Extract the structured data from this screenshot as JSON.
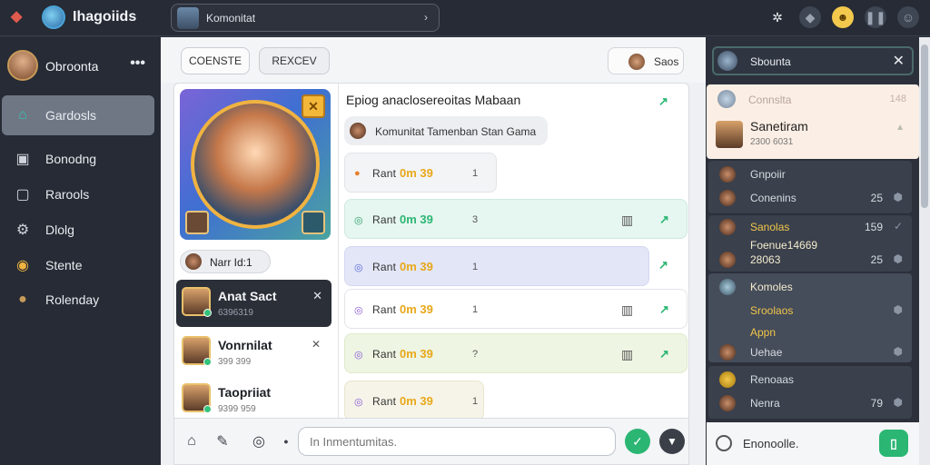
{
  "topbar": {
    "title": "Ihagoiids",
    "search_text": "Komonitat",
    "search_arrow": "›",
    "icons": [
      "gear-icon",
      "puzzle-icon",
      "emoji-icon",
      "pause-icon",
      "profile-icon"
    ]
  },
  "sidebar": {
    "user_name": "Obroonta",
    "menu_glyph": "•••",
    "items": [
      {
        "label": "Gardosls",
        "icon": "home-icon"
      },
      {
        "label": "Bonodng",
        "icon": "store-icon"
      },
      {
        "label": "Rarools",
        "icon": "frame-icon"
      },
      {
        "label": "Dlolg",
        "icon": "settings-icon"
      },
      {
        "label": "Stente",
        "icon": "coin-icon"
      },
      {
        "label": "Rolenday",
        "icon": "avatar-icon"
      }
    ]
  },
  "main": {
    "buttons": {
      "b1": "COENSTE",
      "b2": "REXCEV",
      "save": "Saos"
    },
    "tag_chip": "Narr Id:1",
    "conversations": [
      {
        "name": "Anat Sact",
        "sub": "6396319",
        "selected": true
      },
      {
        "name": "Vonrnilat",
        "sub": "399 399",
        "selected": false
      },
      {
        "name": "Taopriiat",
        "sub": "9399 959",
        "selected": false
      }
    ],
    "message_header": "Epiog anaclosereoitas Mabaan",
    "info_chip": "Komunitat Tamenban Stan Gama",
    "bubbles": [
      {
        "label": "Rant",
        "answer": "0m 39",
        "tail": "1",
        "tone": "plain"
      },
      {
        "label": "Rant",
        "answer": "0m 39",
        "tail": "3",
        "tone": "green"
      },
      {
        "label": "Rant",
        "answer": "0m 39",
        "tail": "1",
        "tone": "lavender"
      },
      {
        "label": "Rant",
        "answer": "0m 39",
        "tail": "1",
        "tone": "white"
      },
      {
        "label": "Rant",
        "answer": "0m 39",
        "tail": "?",
        "tone": "lime"
      },
      {
        "label": "Rant",
        "answer": "0m 39",
        "tail": "1",
        "tone": "cream"
      }
    ],
    "composer_placeholder": "In Inmentumitas."
  },
  "right": {
    "search_text": "Sbounta",
    "card": {
      "top_label": "Connslta",
      "top_num": "148",
      "name": "Sanetiram",
      "sub": "2300 6031"
    },
    "rows": [
      {
        "label": "Gnpoiir",
        "num": ""
      },
      {
        "label": "Conenins",
        "num": "25"
      },
      {
        "label": "Sanolas",
        "num": "159"
      },
      {
        "label": "Foenue14669",
        "num": ""
      },
      {
        "label": "28063",
        "num": "25"
      },
      {
        "label": "Komoles",
        "num": ""
      },
      {
        "label": "Sroolaos",
        "num": ""
      },
      {
        "label": "Appn",
        "num": ""
      },
      {
        "label": "Uehae",
        "num": ""
      },
      {
        "label": "Renoaas",
        "num": ""
      },
      {
        "label": "Nenra",
        "num": "79"
      }
    ],
    "bottom_text": "Enonoolle."
  },
  "colors": {
    "accent": "#2bb673",
    "sidebar_bg": "#262b35",
    "active_item": "#6f7785"
  }
}
